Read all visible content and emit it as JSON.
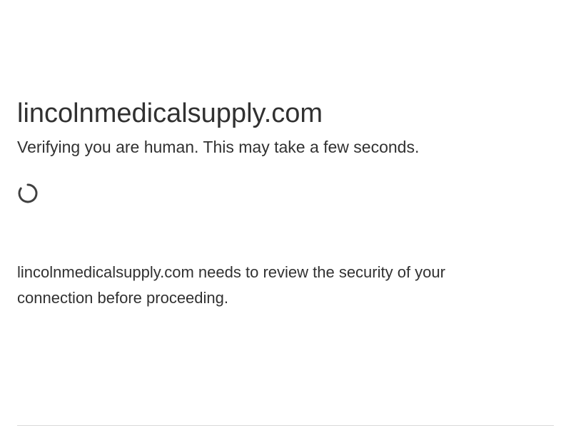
{
  "page": {
    "site_title": "lincolnmedicalsupply.com",
    "subtitle": "Verifying you are human. This may take a few seconds.",
    "spinner_icon": "loading-spinner-icon",
    "description": "lincolnmedicalsupply.com needs to review the security of your connection before proceeding."
  },
  "colors": {
    "text": "#313131",
    "spinner": "#404040",
    "divider": "#d9d9d9",
    "background": "#ffffff"
  }
}
